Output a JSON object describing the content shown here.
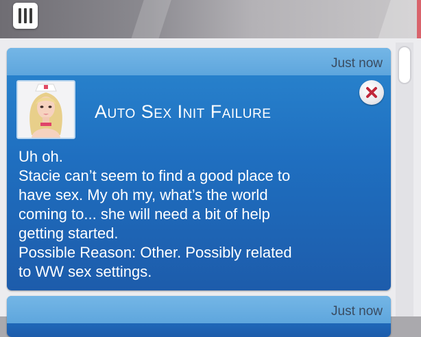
{
  "menu": {
    "icon": "menu-bars-icon"
  },
  "notifications": [
    {
      "timestamp": "Just now",
      "title": "Auto Sex Init Failure",
      "portrait_icon": "sim-portrait",
      "close_icon": "close-icon",
      "body_lines": [
        "Uh oh.",
        "Stacie can’t seem to find a good place to",
        "have sex. My oh my, what’s the world",
        "coming to... she will need a bit of help",
        "getting started.",
        "Possible Reason: Other. Possibly related",
        "to WW sex settings."
      ]
    },
    {
      "timestamp": "Just now"
    }
  ],
  "colors": {
    "card_blue": "#1f6fc0",
    "header_blue": "#5ea6dd",
    "close_red": "#c0263a"
  }
}
